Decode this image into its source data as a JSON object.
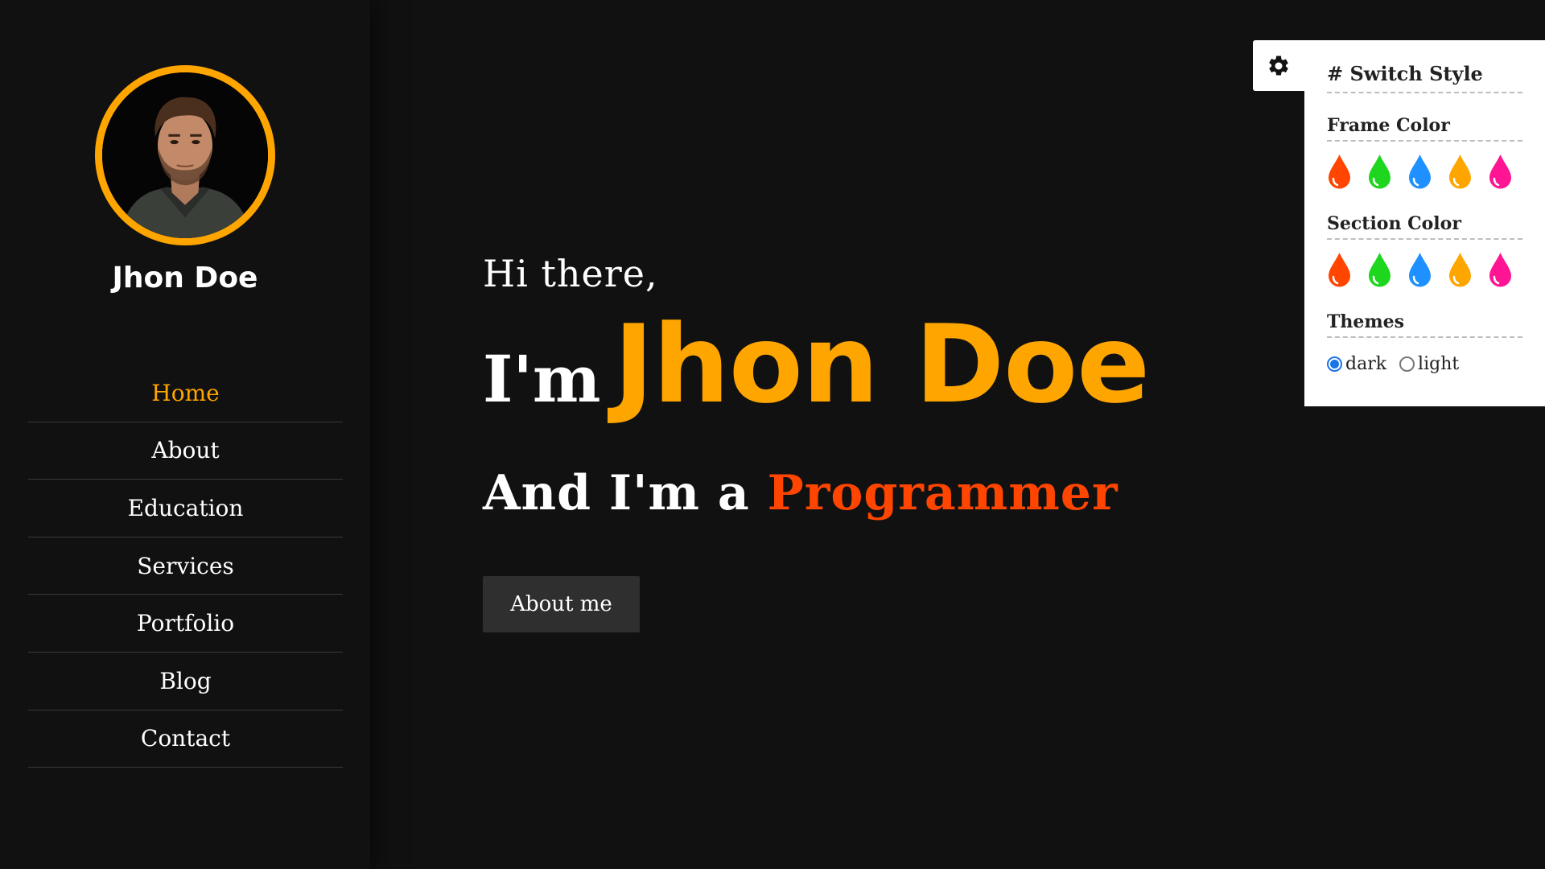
{
  "colors": {
    "accent": "#ffa500",
    "highlight": "#ff4500",
    "background": "#111111",
    "swatches": [
      "#ff4500",
      "#1ed61e",
      "#1e90ff",
      "#ffa500",
      "#ff1493"
    ]
  },
  "sidebar": {
    "avatar_icon": "profile-photo",
    "name": "Jhon Doe",
    "nav": [
      {
        "label": "Home",
        "active": true
      },
      {
        "label": "About",
        "active": false
      },
      {
        "label": "Education",
        "active": false
      },
      {
        "label": "Services",
        "active": false
      },
      {
        "label": "Portfolio",
        "active": false
      },
      {
        "label": "Blog",
        "active": false
      },
      {
        "label": "Contact",
        "active": false
      }
    ]
  },
  "hero": {
    "greeting": "Hi there,",
    "intro_prefix": "I'm",
    "intro_name": "Jhon Doe",
    "role_prefix": "And I'm a",
    "role_word": "Programmer",
    "button_label": "About me"
  },
  "switcher": {
    "toggle_icon": "gear-icon",
    "title": "# Switch Style",
    "frame_color_label": "Frame Color",
    "section_color_label": "Section Color",
    "themes_label": "Themes",
    "themes": [
      {
        "label": "dark",
        "checked": true
      },
      {
        "label": "light",
        "checked": false
      }
    ]
  }
}
